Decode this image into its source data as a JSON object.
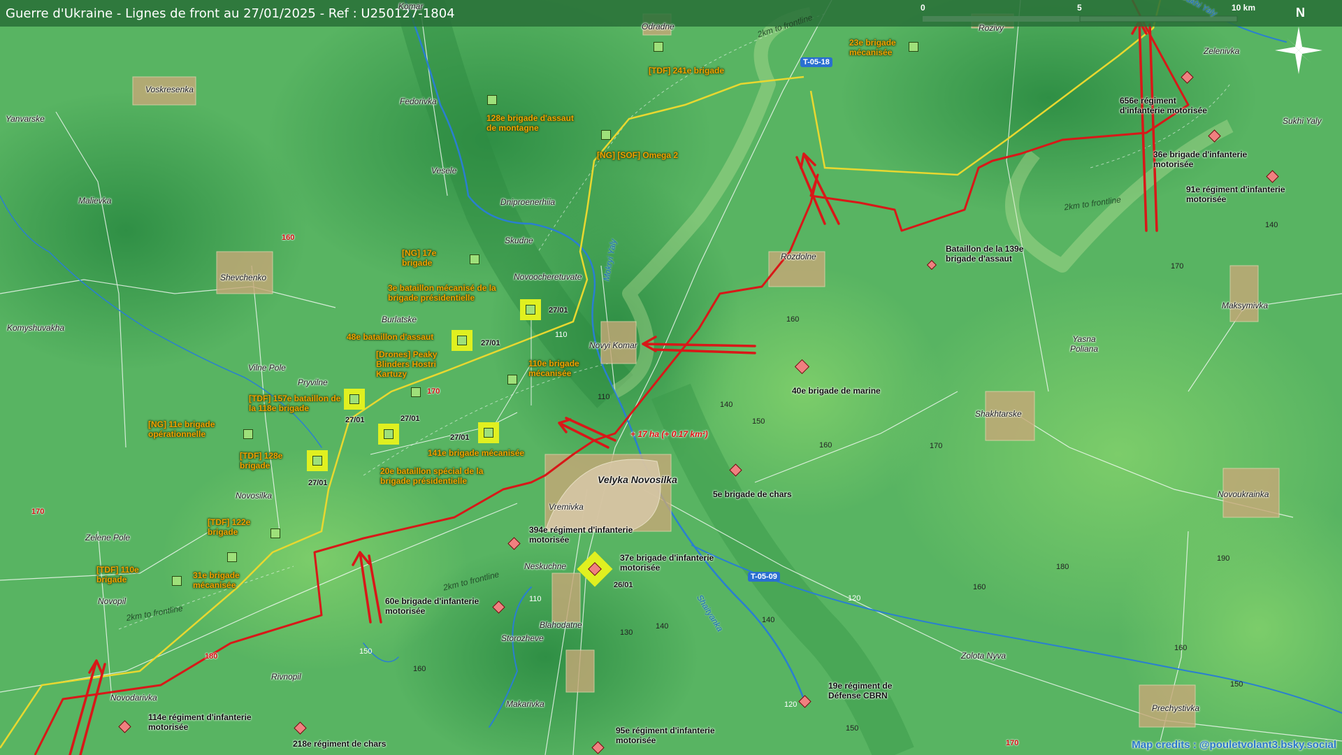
{
  "title": "Guerre d'Ukraine - Lignes de front au 27/01/2025 - Ref : U250127-1804",
  "scale": {
    "zero": "0",
    "mid": "5",
    "end": "10 km"
  },
  "north": "N",
  "colors": {
    "front_line": "#d81818",
    "buffer_line": "#e8d830",
    "ua_unit": "#9ee07a",
    "ru_unit": "#f08080",
    "highlight": "#e0f020",
    "river": "#2a7fd0"
  },
  "towns": [
    {
      "id": "voskresenka",
      "name": "Voskresenka"
    },
    {
      "id": "yanvarske",
      "name": "Yanvarske"
    },
    {
      "id": "malievka",
      "name": "Malievka"
    },
    {
      "id": "shevchenko",
      "name": "Shevchenko"
    },
    {
      "id": "komyshuvakha",
      "name": "Komyshuvakha"
    },
    {
      "id": "vilnepole",
      "name": "Vilne Pole"
    },
    {
      "id": "pryvilne",
      "name": "Pryvilne"
    },
    {
      "id": "novosilka",
      "name": "Novosilka"
    },
    {
      "id": "zelenepole",
      "name": "Zelene Pole"
    },
    {
      "id": "novopil",
      "name": "Novopil"
    },
    {
      "id": "novodarivka",
      "name": "Novodarivka"
    },
    {
      "id": "rivnopil",
      "name": "Rivnopil"
    },
    {
      "id": "komar",
      "name": "Komar"
    },
    {
      "id": "fedorivka",
      "name": "Fedorivka"
    },
    {
      "id": "vesele",
      "name": "Vesele"
    },
    {
      "id": "dniproenerhiia",
      "name": "Dniproenerhiia"
    },
    {
      "id": "skudne",
      "name": "Skudne"
    },
    {
      "id": "novoocheretuvate",
      "name": "Novoocheretuvate"
    },
    {
      "id": "burlatske",
      "name": "Burlatske"
    },
    {
      "id": "novyikomar",
      "name": "Novyi Komar"
    },
    {
      "id": "velyka",
      "name": "Velyka Novosilka"
    },
    {
      "id": "vremivka",
      "name": "Vremivka"
    },
    {
      "id": "neskuchne",
      "name": "Neskuchne"
    },
    {
      "id": "blahodatne",
      "name": "Blahodatne"
    },
    {
      "id": "storozheve",
      "name": "Storozheve"
    },
    {
      "id": "makarivka",
      "name": "Makarivka"
    },
    {
      "id": "odradne",
      "name": "Odradne"
    },
    {
      "id": "rozdolne",
      "name": "Rozdolne"
    },
    {
      "id": "rozivy",
      "name": "Rozivy"
    },
    {
      "id": "zelenivka",
      "name": "Zelenivka"
    },
    {
      "id": "sukhiyaly",
      "name": "Sukhi Yaly"
    },
    {
      "id": "maksymivka",
      "name": "Maksymivka"
    },
    {
      "id": "yasnapoliana",
      "name": "Yasna Poliana"
    },
    {
      "id": "shakhtarske",
      "name": "Shakhtarske"
    },
    {
      "id": "novoukrainka",
      "name": "Novoukrainka"
    },
    {
      "id": "zolotanyva",
      "name": "Zolota Nyva"
    },
    {
      "id": "prechystivka",
      "name": "Prechystivka"
    }
  ],
  "ua_units": [
    {
      "id": "u1",
      "text": "128e brigade d'assaut de montagne"
    },
    {
      "id": "u2",
      "text": "[TDF] 241e brigade"
    },
    {
      "id": "u3",
      "text": "[NG] [SOF] Omega 2"
    },
    {
      "id": "u4",
      "text": "23e brigade mécanisée"
    },
    {
      "id": "u5",
      "text": "[NG] 17e brigade"
    },
    {
      "id": "u6",
      "text": "3e bataillon mécanisé de la brigade présidentielle"
    },
    {
      "id": "u7",
      "text": "48e bataillon d'assaut"
    },
    {
      "id": "u8",
      "text": "[Drones] Peaky Blinders Hostri Kartuzy"
    },
    {
      "id": "u9",
      "text": "110e brigade mécanisée"
    },
    {
      "id": "u10",
      "text": "[TDF] 157e bataillon de la 118e brigade"
    },
    {
      "id": "u11",
      "text": "[NG] 11e brigade opérationnelle"
    },
    {
      "id": "u12",
      "text": "[TDF] 128e brigade"
    },
    {
      "id": "u13",
      "text": "141e brigade mécanisée"
    },
    {
      "id": "u14",
      "text": "20e bataillon spécial de la brigade présidentielle"
    },
    {
      "id": "u15",
      "text": "[TDF] 122e brigade"
    },
    {
      "id": "u16",
      "text": "[TDF] 110e brigade"
    },
    {
      "id": "u17",
      "text": "31e brigade mécanisée"
    }
  ],
  "ru_units": [
    {
      "id": "r1",
      "text": "656e régiment d'infanterie motorisée"
    },
    {
      "id": "r2",
      "text": "36e brigade d'infanterie motorisée"
    },
    {
      "id": "r3",
      "text": "91e régiment d'infanterie motorisée"
    },
    {
      "id": "r4",
      "text": "Bataillon de la 139e brigade d'assaut"
    },
    {
      "id": "r5",
      "text": "40e brigade de marine"
    },
    {
      "id": "r6",
      "text": "5e brigade de chars"
    },
    {
      "id": "r7",
      "text": "394e régiment d'infanterie motorisée"
    },
    {
      "id": "r8",
      "text": "37e brigade d'infanterie motorisée"
    },
    {
      "id": "r9",
      "text": "60e brigade d'infanterie motorisée"
    },
    {
      "id": "r10",
      "text": "19e régiment de Défense CBRN"
    },
    {
      "id": "r11",
      "text": "114e régiment d'infanterie motorisée"
    },
    {
      "id": "r12",
      "text": "218e régiment de chars"
    },
    {
      "id": "r13",
      "text": "95e régiment d'infanterie motorisée"
    }
  ],
  "dates": {
    "d2701": "27/01",
    "d2601": "26/01"
  },
  "roads": {
    "t0518": "T-05-18",
    "t0509": "T-05-09"
  },
  "rivers": {
    "mokryi": "Mokryi Yaly",
    "shaitanka": "Shaityanka",
    "sukhi": "Sukhi Yaly"
  },
  "gain": "+ 17 ha (+ 0.17 km²)",
  "buffer": "2km to frontline",
  "elev": {
    "e110": "110",
    "e120": "120",
    "e130": "130",
    "e140": "140",
    "e150": "150",
    "e160": "160",
    "e170": "170",
    "e180": "180",
    "e190": "190"
  },
  "credit": "Map credits : @pouletvolant3.bsky.social"
}
